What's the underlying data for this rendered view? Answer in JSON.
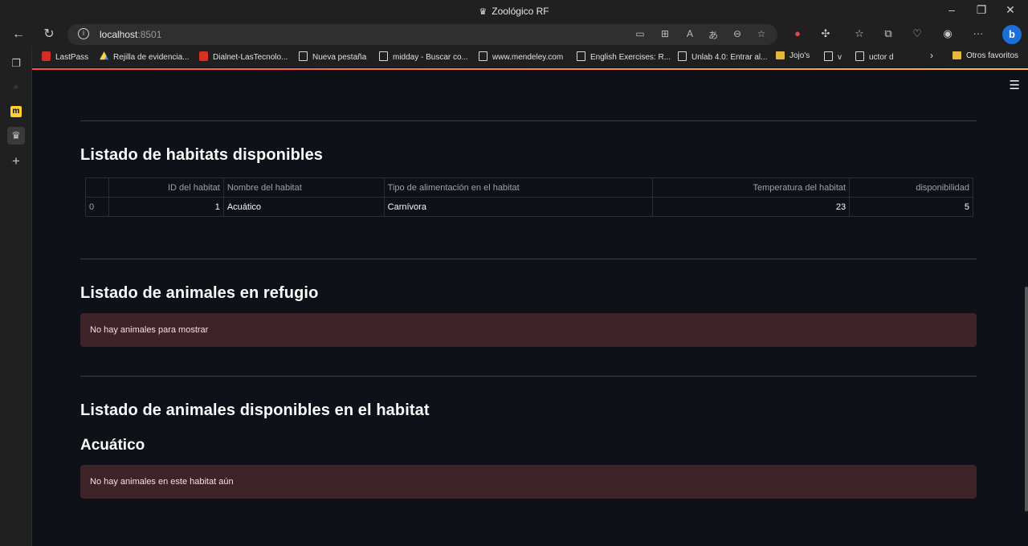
{
  "browser": {
    "window_title": "Zoológico RF",
    "url_host": "localhost",
    "url_port": ":8501",
    "bookmarks": [
      {
        "label": "LastPass",
        "icon": "lastpass-icon"
      },
      {
        "label": "Rejilla de evidencia...",
        "icon": "google-drive-icon"
      },
      {
        "label": "Dialnet-LasTecnolo...",
        "icon": "pdf-icon"
      },
      {
        "label": "Nueva pestaña",
        "icon": "page-icon"
      },
      {
        "label": "midday - Buscar co...",
        "icon": "page-icon"
      },
      {
        "label": "www.mendeley.com",
        "icon": "page-icon"
      },
      {
        "label": "English Exercises: R...",
        "icon": "page-icon"
      },
      {
        "label": "Unlab 4.0: Entrar al...",
        "icon": "page-icon"
      },
      {
        "label": "Jojo's",
        "icon": "folder-icon"
      },
      {
        "label": "v",
        "icon": "page-icon"
      },
      {
        "label": "uctor d",
        "icon": "page-icon"
      }
    ],
    "other_favorites": "Otros favoritos"
  },
  "sections": {
    "habitats": {
      "title": "Listado de habitats disponibles",
      "table": {
        "columns": [
          "",
          "ID del habitat",
          "Nombre del habitat",
          "Tipo de alimentación en el habitat",
          "Temperatura del habitat",
          "disponibilidad"
        ],
        "rows": [
          [
            "0",
            "1",
            "Acuático",
            "Carnívora",
            "23",
            "5"
          ]
        ]
      }
    },
    "refugio": {
      "title": "Listado de animales en refugio",
      "message": "No hay animales para mostrar"
    },
    "habitat_animals": {
      "title": "Listado de animales disponibles en el habitat",
      "habitat_name": "Acuático",
      "message": "No hay animales en este habitat aún"
    }
  }
}
